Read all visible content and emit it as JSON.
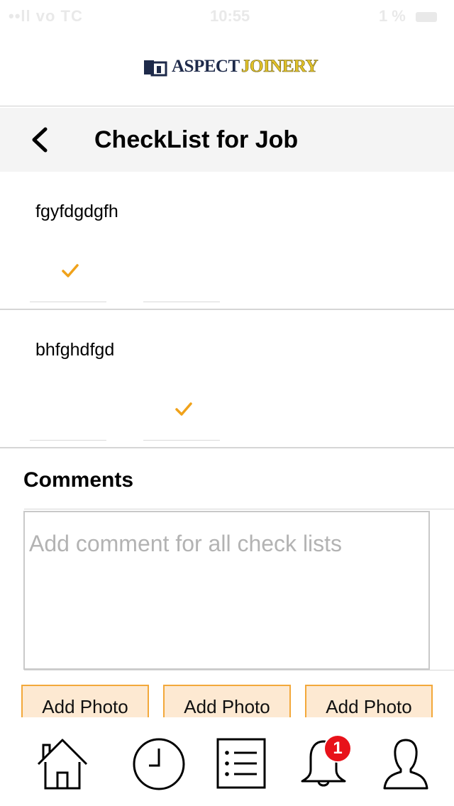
{
  "status_bar": {
    "carrier": "••ll vo TC",
    "time": "10:55",
    "battery": "1 %"
  },
  "brand": {
    "name_part1": "ASPECT",
    "name_part2": "JOINERY",
    "colors": {
      "navy": "#1e2a4a",
      "gold": "#e2c22a"
    }
  },
  "header": {
    "back_icon": "chevron-left-icon",
    "title": "CheckList for Job"
  },
  "checklist": {
    "items": [
      {
        "label": "fgyfdgdgfh",
        "checked_option": 1
      },
      {
        "label": "bhfghdfgd",
        "checked_option": 2
      }
    ],
    "check_color": "#f0a21a"
  },
  "comments": {
    "title": "Comments",
    "value": "",
    "placeholder": "Add comment for all check lists"
  },
  "photos": {
    "buttons": [
      {
        "label": "Add Photo"
      },
      {
        "label": "Add Photo"
      },
      {
        "label": "Add Photo"
      }
    ],
    "fill": "#fde9d2",
    "border": "#f3a83a"
  },
  "tab_bar": {
    "tabs": [
      {
        "icon": "home-icon"
      },
      {
        "icon": "clock-icon"
      },
      {
        "icon": "list-icon"
      },
      {
        "icon": "bell-icon",
        "badge": "1"
      },
      {
        "icon": "user-icon"
      }
    ],
    "badge_color": "#e8121a"
  }
}
